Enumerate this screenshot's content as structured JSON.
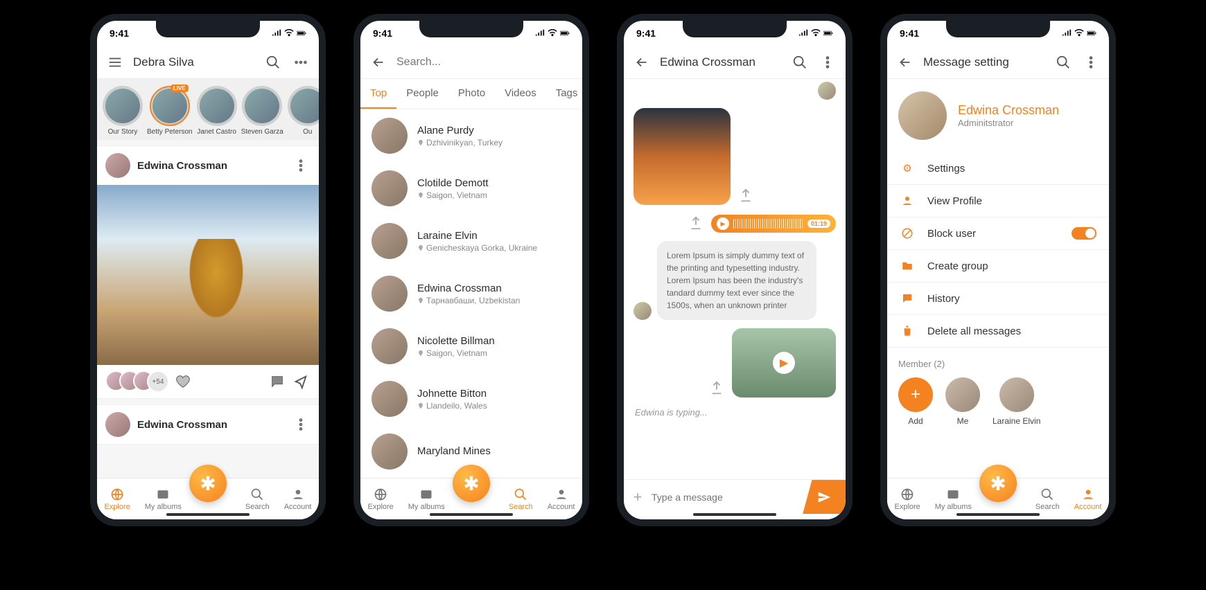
{
  "status": {
    "time": "9:41"
  },
  "nav": {
    "explore": "Explore",
    "albums": "My albums",
    "search": "Search",
    "account": "Account"
  },
  "screen1": {
    "title": "Debra Silva",
    "stories": [
      {
        "label": "Our Story"
      },
      {
        "label": "Betty Peterson",
        "badge": "LIVE"
      },
      {
        "label": "Janet Castro"
      },
      {
        "label": "Steven Garza"
      },
      {
        "label": "Ou"
      }
    ],
    "feed": [
      {
        "author": "Edwina Crossman",
        "likesExtra": "+54"
      },
      {
        "author": "Edwina Crossman"
      }
    ]
  },
  "screen2": {
    "searchPlaceholder": "Search...",
    "tabs": [
      "Top",
      "People",
      "Photo",
      "Videos",
      "Tags"
    ],
    "activeTab": 0,
    "people": [
      {
        "name": "Alane Purdy",
        "loc": "Dzhivinikyan, Turkey"
      },
      {
        "name": "Clotilde Demott",
        "loc": "Saigon, Vietnam"
      },
      {
        "name": "Laraine Elvin",
        "loc": "Genicheskaya Gorka, Ukraine"
      },
      {
        "name": "Edwina Crossman",
        "loc": "Тарнавбаши, Uzbekistan"
      },
      {
        "name": "Nicolette Billman",
        "loc": "Saigon, Vietnam"
      },
      {
        "name": "Johnette Bitton",
        "loc": "Llandeilo, Wales"
      },
      {
        "name": "Maryland Mines",
        "loc": ""
      }
    ]
  },
  "screen3": {
    "title": "Edwina Crossman",
    "audioDuration": "01:19",
    "textMsg": "Lorem Ipsum is simply dummy text of the printing and typesetting industry. Lorem Ipsum has been the industry's tandard dummy text ever since the 1500s, when an unknown printer",
    "typing": "Edwina is typing...",
    "composerPlaceholder": "Type a message"
  },
  "screen4": {
    "title": "Message setting",
    "profileName": "Edwina Crossman",
    "profileRole": "Adminitstrator",
    "settings": {
      "settings": "Settings",
      "viewProfile": "View Profile",
      "blockUser": "Block user",
      "createGroup": "Create group",
      "history": "History",
      "deleteAll": "Delete all messages"
    },
    "memberHeader": "Member (2)",
    "members": {
      "add": "Add",
      "me": "Me",
      "other": "Laraine Elvin"
    }
  }
}
